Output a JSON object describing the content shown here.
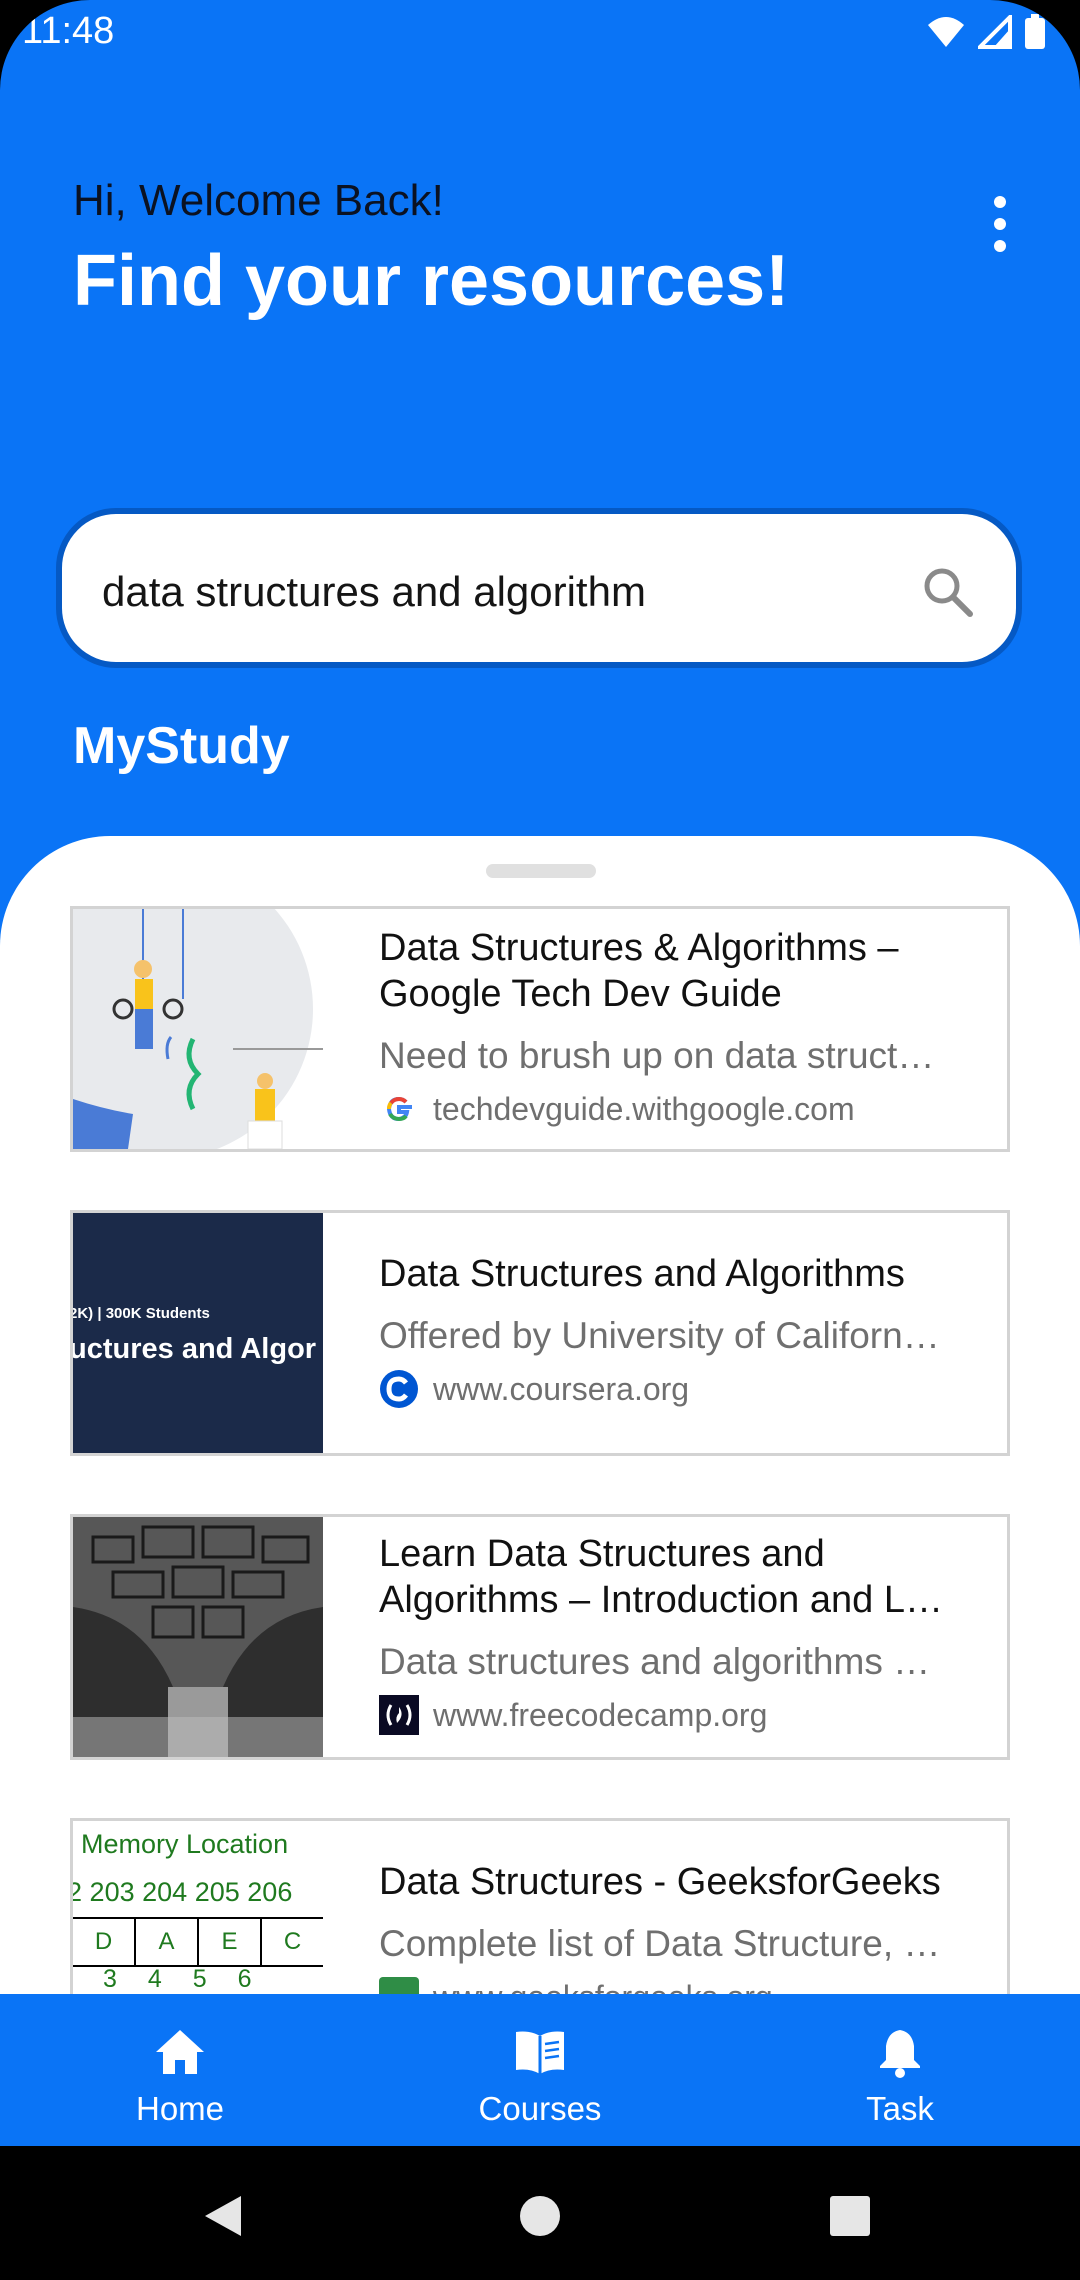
{
  "status_bar": {
    "time": "11:48"
  },
  "header": {
    "greeting": "Hi, Welcome Back!",
    "headline": "Find your resources!"
  },
  "search": {
    "value": "data structures and algorithm"
  },
  "section_title": "MyStudy",
  "results": [
    {
      "title": "Data Structures & Algorithms – Google Tech Dev Guide",
      "description": "Need to brush up on data struct…",
      "source": "techdevguide.withgoogle.com",
      "source_icon": "google-icon"
    },
    {
      "title": "Data Structures and Algorithms",
      "description": "Offered by University of Californ…",
      "source": "www.coursera.org",
      "source_icon": "coursera-icon",
      "thumbnail_text": [
        "2K) | 300K Students",
        "uctures and Algor"
      ]
    },
    {
      "title": "Learn Data Structures and Algorithms – Introduction and L…",
      "description": "Data structures and algorithms …",
      "source": "www.freecodecamp.org",
      "source_icon": "freecodecamp-icon"
    },
    {
      "title": "Data Structures - GeeksforGeeks",
      "description": "Complete list of Data Structure, …",
      "source": "www.geeksforgeeks.org",
      "source_icon": "geeksforgeeks-icon",
      "thumbnail_text": {
        "heading": "Memory Location",
        "addresses": [
          "2",
          "203",
          "204",
          "205",
          "206"
        ],
        "cells": [
          "D",
          "A",
          "E",
          "C"
        ],
        "indices": [
          "3",
          "4",
          "5",
          "6"
        ]
      }
    }
  ],
  "bottom_nav": [
    {
      "label": "Home",
      "icon": "home-icon"
    },
    {
      "label": "Courses",
      "icon": "book-icon"
    },
    {
      "label": "Task",
      "icon": "bell-icon"
    }
  ],
  "colors": {
    "primary": "#0a74f6",
    "search_border": "#0559c4",
    "card_border": "#d3d3d3",
    "text_secondary": "#6f6f6f"
  }
}
